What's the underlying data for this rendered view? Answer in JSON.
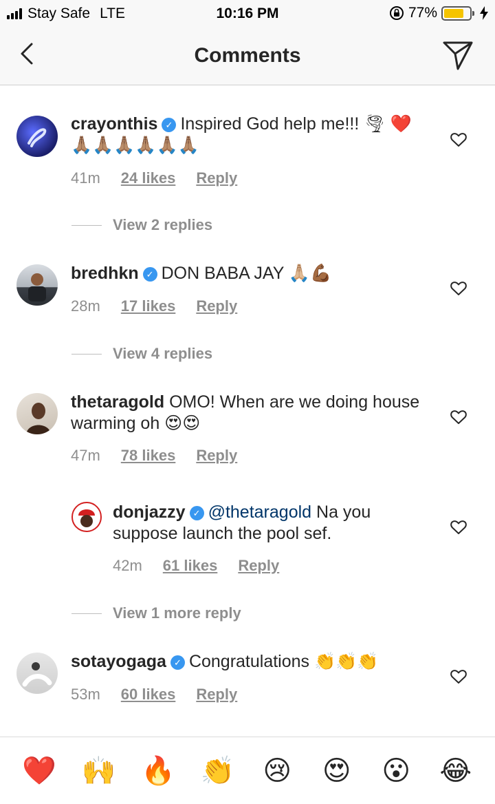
{
  "status": {
    "carrier": "Stay Safe",
    "network": "LTE",
    "time": "10:16 PM",
    "battery": "77%",
    "battery_level": 0.77
  },
  "nav": {
    "title": "Comments"
  },
  "comments": [
    {
      "username": "crayonthis",
      "text": "Inspired God help me!!! 🌪 ❤️🙏🏽🙏🏽🙏🏽🙏🏽🙏🏽🙏🏽",
      "time": "41m",
      "likes": "24 likes",
      "reply": "Reply",
      "view_replies": "View 2 replies"
    },
    {
      "username": "bredhkn",
      "text": "DON BABA JAY 🙏🏼💪🏾",
      "time": "28m",
      "likes": "17 likes",
      "reply": "Reply",
      "view_replies": "View 4 replies"
    },
    {
      "username": "thetaragold",
      "text": "OMO! When are we doing house warming oh 😍😍",
      "time": "47m",
      "likes": "78 likes",
      "reply": "Reply"
    },
    {
      "username": "donjazzy",
      "mention": "@thetaragold",
      "text": "Na you suppose launch the pool sef.",
      "time": "42m",
      "likes": "61 likes",
      "reply": "Reply",
      "view_replies": "View 1 more reply"
    },
    {
      "username": "sotayogaga",
      "text": "Congratulations 👏👏👏",
      "time": "53m",
      "likes": "60 likes",
      "reply": "Reply"
    }
  ],
  "reactions": [
    "❤️",
    "🙌",
    "🔥",
    "👏",
    "😢",
    "😍",
    "😮",
    "😂"
  ],
  "colors": {
    "verified": "#3897f0",
    "battery": "#f5c400",
    "muted": "#8e8e8e"
  }
}
